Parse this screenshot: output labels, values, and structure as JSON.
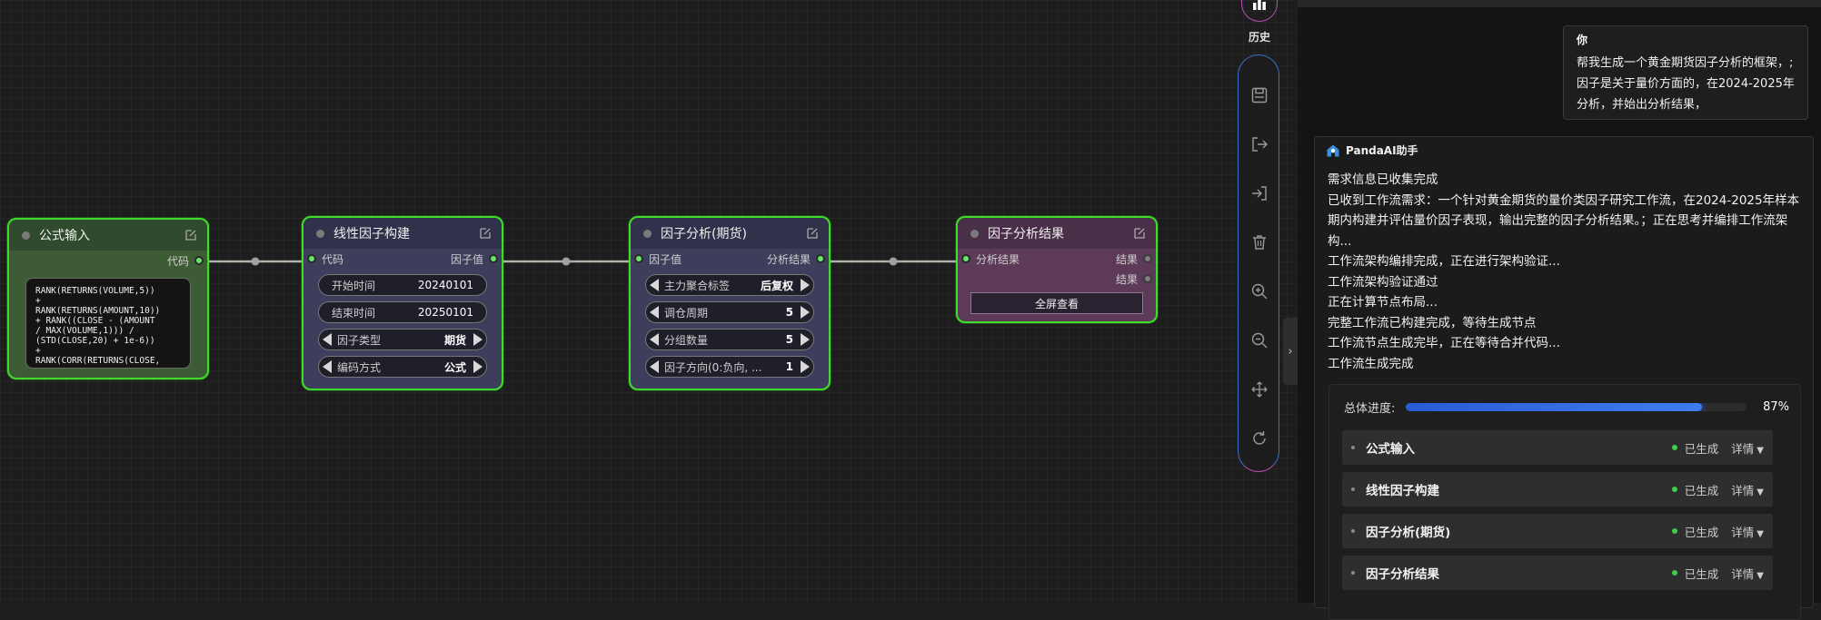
{
  "canvas": {
    "nodes": {
      "formula_input": {
        "title": "公式输入",
        "output_label": "代码",
        "code": "RANK(RETURNS(VOLUME,5))\n+\nRANK(RETURNS(AMOUNT,10))\n+ RANK((CLOSE - (AMOUNT\n/ MAX(VOLUME,1))) /\n(STD(CLOSE,20) + 1e-6))\n+\nRANK(CORR(RETURNS(CLOSE,"
      },
      "linear_factor": {
        "title": "线性因子构建",
        "input_label": "代码",
        "output_label": "因子值",
        "start_label": "开始时间",
        "start_value": "20240101",
        "end_label": "结束时间",
        "end_value": "20250101",
        "factor_type_label": "因子类型",
        "factor_type_value": "期货",
        "encoding_label": "编码方式",
        "encoding_value": "公式"
      },
      "factor_analysis": {
        "title": "因子分析(期货)",
        "input_label": "因子值",
        "output_label": "分析结果",
        "contract_label": "主力聚合标签",
        "contract_value": "后复权",
        "period_label": "调仓周期",
        "period_value": "5",
        "groups_label": "分组数量",
        "groups_value": "5",
        "direction_label": "因子方向(0:负向, ...",
        "direction_value": "1"
      },
      "factor_result": {
        "title": "因子分析结果",
        "input_label": "分析结果",
        "output_label_1": "结果",
        "output_label_2": "结果",
        "fullscreen_label": "全屏查看"
      }
    }
  },
  "toolbar": {
    "history_label": "历史",
    "tools": [
      "save-icon",
      "export-icon",
      "import-icon",
      "delete-icon",
      "zoom-in-icon",
      "zoom-out-icon",
      "move-icon",
      "refresh-icon"
    ],
    "collapse_glyph": "›"
  },
  "chat": {
    "user": {
      "name": "你",
      "text": "帮我生成一个黄金期货因子分析的框架，;因子是关于量价方面的，在2024-2025年分析，并始出分析结果，"
    },
    "assistant": {
      "name": "PandaAI助手",
      "lines": [
        "需求信息已收集完成",
        "已收到工作流需求：一个针对黄金期货的量价类因子研究工作流，在2024-2025年样本期内构建并评估量价因子表现，输出完整的因子分析结果。；正在思考并编排工作流架构...",
        "工作流架构编排完成，正在进行架构验证...",
        "工作流架构验证通过",
        "正在计算节点布局...",
        "完整工作流已构建完成，等待生成节点",
        "工作流节点生成完毕，正在等待合并代码...",
        "工作流生成完成"
      ],
      "progress": {
        "label": "总体进度:",
        "value": 87,
        "text": "87%"
      },
      "steps": [
        {
          "name": "公式输入",
          "status": "已生成",
          "detail": "详情"
        },
        {
          "name": "线性因子构建",
          "status": "已生成",
          "detail": "详情"
        },
        {
          "name": "因子分析(期货)",
          "status": "已生成",
          "detail": "详情"
        },
        {
          "name": "因子分析结果",
          "status": "已生成",
          "detail": "详情"
        }
      ]
    }
  },
  "colors": {
    "node_border": "#3fdc2c",
    "formula_header": "#2f4a2c",
    "formula_body": "#3d5c35",
    "linear_header": "#30314a",
    "linear_body": "#3c3e5c",
    "result_header": "#4a2f48",
    "result_body": "#5c3a58",
    "progress": "#3f7cf0",
    "status_green": "#3fd04a"
  }
}
